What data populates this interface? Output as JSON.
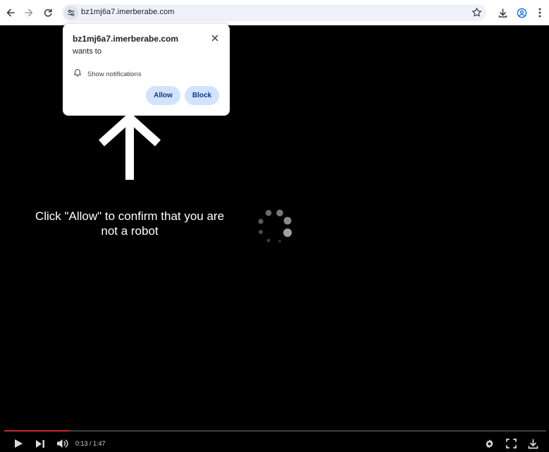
{
  "browser": {
    "url": "bz1mj6a7.imerberabe.com",
    "icons": {
      "back": "back-arrow-icon",
      "forward": "forward-arrow-icon",
      "reload": "reload-icon",
      "site_info": "tune-icon",
      "bookmark": "star-icon",
      "downloads": "download-icon",
      "profile": "profile-icon",
      "menu": "kebab-menu-icon"
    }
  },
  "popup": {
    "domain": "bz1mj6a7.imerberabe.com",
    "wants_to": "wants to",
    "permission_label": "Show notifications",
    "allow_label": "Allow",
    "block_label": "Block"
  },
  "page": {
    "message": "Click \"Allow\" to confirm that you are not a robot"
  },
  "player": {
    "time": "0:13 / 1:47",
    "progress": 0.12,
    "accent_color": "#c62828"
  }
}
